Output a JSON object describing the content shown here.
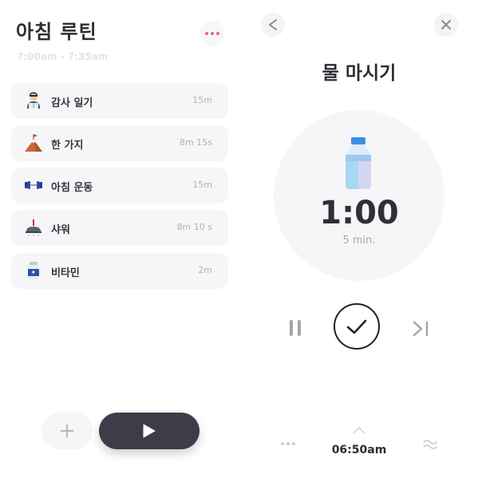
{
  "routine": {
    "title": "아침 루틴",
    "time_range": "7:00am - 7:35am",
    "tasks": [
      {
        "name": "감사 일기",
        "duration": "15m",
        "icon": "reading-person-icon"
      },
      {
        "name": "한 가지",
        "duration": "8m 15s",
        "icon": "mountain-flag-icon"
      },
      {
        "name": "아침 운동",
        "duration": "15m",
        "icon": "dumbbell-icon"
      },
      {
        "name": "샤워",
        "duration": "8m 10 s",
        "icon": "shower-icon"
      },
      {
        "name": "비타민",
        "duration": "2m",
        "icon": "vitamin-bottle-icon"
      }
    ],
    "add_label": "+"
  },
  "player": {
    "current_task": "물 마시기",
    "timer": "1:00",
    "total": "5 min.",
    "icon": "water-bottle-icon",
    "clock": "06:50am"
  },
  "colors": {
    "accent_dots": "#e06b7a",
    "dark_button": "#3c3d48",
    "card_bg": "#f6f6f8",
    "bottle_blue": "#5aa6e8"
  }
}
